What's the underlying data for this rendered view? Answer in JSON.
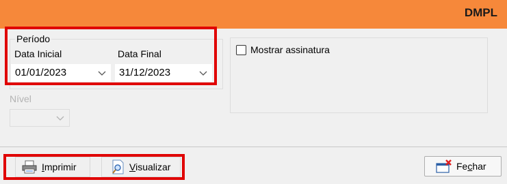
{
  "window": {
    "title": "DMPL",
    "header_color": "#f6883a"
  },
  "periodo": {
    "legend": "Período",
    "data_inicial_label": "Data Inicial",
    "data_inicial_value": "01/01/2023",
    "data_final_label": "Data Final",
    "data_final_value": "31/12/2023"
  },
  "nivel": {
    "label": "Nível",
    "value": "",
    "enabled": false
  },
  "options": {
    "mostrar_assinatura_label": "Mostrar assinatura",
    "mostrar_assinatura_checked": false
  },
  "buttons": {
    "imprimir_hotkey": "I",
    "imprimir_rest": "mprimir",
    "visualizar_hotkey": "V",
    "visualizar_rest": "isualizar",
    "fechar_prefix": "Fe",
    "fechar_hotkey": "c",
    "fechar_rest": "har"
  },
  "icons": {
    "dropdown": "chevron-down-icon",
    "imprimir": "printer-icon",
    "visualizar": "magnifier-document-icon",
    "fechar": "close-window-icon"
  },
  "highlight_color": "#e00000"
}
